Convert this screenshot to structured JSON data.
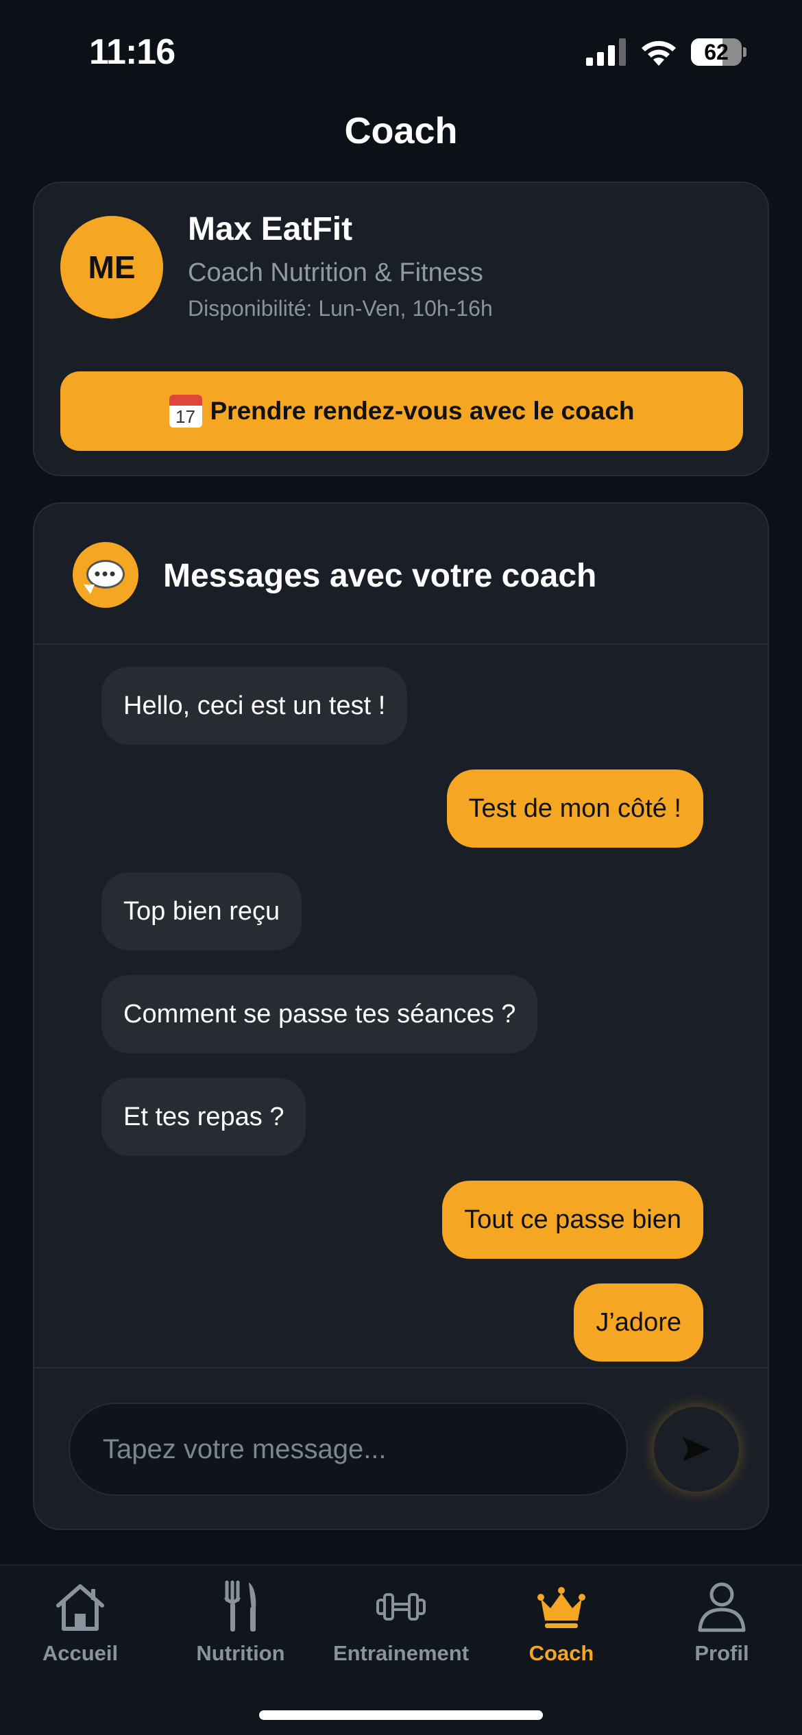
{
  "status_bar": {
    "time": "11:16",
    "battery": "62",
    "battery_level": 0.62
  },
  "page": {
    "title": "Coach"
  },
  "coach": {
    "initials": "ME",
    "name": "Max EatFit",
    "role": "Coach Nutrition & Fitness",
    "availability": "Disponibilité: Lun-Ven, 10h-16h",
    "book_button": "Prendre rendez-vous avec le coach",
    "calendar_day": "17"
  },
  "messages": {
    "header_title": "Messages avec votre coach",
    "items": [
      {
        "text": "Hello, ceci est un test !",
        "direction": "in"
      },
      {
        "text": "Test de mon côté !",
        "direction": "out"
      },
      {
        "text": "Top bien reçu",
        "direction": "in"
      },
      {
        "text": "Comment se passe tes séances ?",
        "direction": "in"
      },
      {
        "text": "Et tes repas ?",
        "direction": "in"
      },
      {
        "text": "Tout ce passe bien",
        "direction": "out"
      },
      {
        "text": "J’adore",
        "direction": "out"
      }
    ],
    "input_placeholder": "Tapez votre message..."
  },
  "tabs": [
    {
      "label": "Accueil",
      "icon": "home-icon",
      "active": false
    },
    {
      "label": "Nutrition",
      "icon": "fork-knife-icon",
      "active": false
    },
    {
      "label": "Entrainement",
      "icon": "dumbbell-icon",
      "active": false
    },
    {
      "label": "Coach",
      "icon": "crown-icon",
      "active": true
    },
    {
      "label": "Profil",
      "icon": "user-icon",
      "active": false
    }
  ],
  "colors": {
    "accent": "#f5a623",
    "background": "#0c1017",
    "card": "#1a1f27",
    "muted": "#8a929e"
  }
}
